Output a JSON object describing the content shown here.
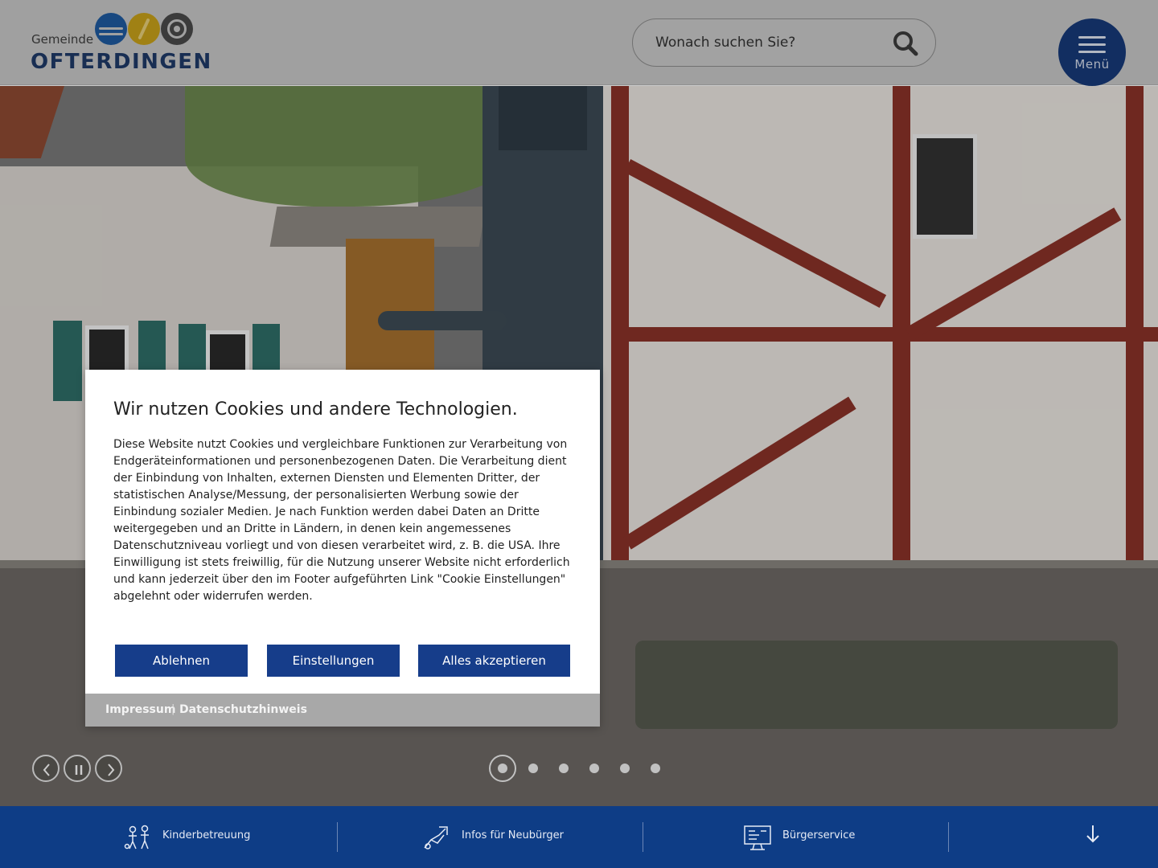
{
  "header": {
    "logo_small": "Gemeinde",
    "logo_big": "OFTERDINGEN",
    "search_placeholder": "Wonach suchen Sie?",
    "menu_label": "Menü"
  },
  "slider": {
    "slide_count": 6,
    "active_slide": 1
  },
  "cookie": {
    "title": "Wir nutzen Cookies und andere Technologien.",
    "text": "Diese Website nutzt Cookies und vergleichbare Funktionen zur Verarbeitung von Endgeräteinformationen und personenbezogenen Daten. Die Verarbeitung dient der Einbindung von Inhalten, externen Diensten und Elementen Dritter, der statistischen Analyse/Messung, der personalisierten Werbung sowie der Einbindung sozialer Medien. Je nach Funktion werden dabei Daten an Dritte weitergegeben und an Dritte in Ländern, in denen kein angemessenes Datenschutzniveau vorliegt und von diesen verarbeitet wird, z. B. die USA. Ihre Einwilligung ist stets freiwillig, für die Nutzung unserer Website nicht erforderlich und kann jederzeit über den im Footer aufgeführten Link \"Cookie Einstellungen\" abgelehnt oder widerrufen werden.",
    "decline_label": "Ablehnen",
    "settings_label": "Einstellungen",
    "accept_label": "Alles akzeptieren",
    "footer_imprint": "Impressum",
    "footer_separator": "|",
    "footer_privacy": "Datenschutzhinweis"
  },
  "quicklinks": [
    {
      "label": "Kinderbetreuung",
      "icon": "children-icon"
    },
    {
      "label": "Infos für Neubürger",
      "icon": "handshake-icon"
    },
    {
      "label": "Bürgerservice",
      "icon": "computer-icon"
    }
  ],
  "colors": {
    "brand_blue": "#0e3d86",
    "button_blue": "#163d8a",
    "logo_gold": "#c9a21a"
  }
}
